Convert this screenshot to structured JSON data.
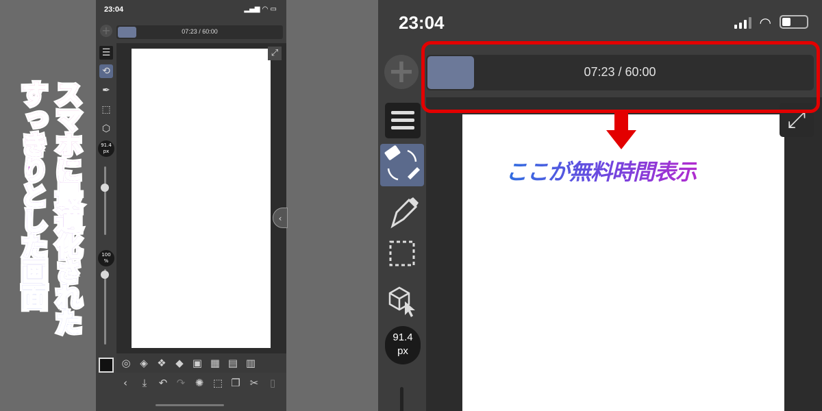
{
  "headline": {
    "line1": "スマホに最適化された",
    "line2": "すっきりとした画面"
  },
  "callout": "ここが無料時間表示",
  "status": {
    "time": "23:04"
  },
  "timer": {
    "text": "07:23 / 60:00",
    "progress_fraction": 0.12
  },
  "brush_size": {
    "value": "91.4",
    "unit": "px"
  },
  "opacity": {
    "value": "100",
    "unit": "%"
  },
  "colors": {
    "progress": "#6c7999",
    "selected_tool": "#5b6a8c",
    "highlight": "#e30000",
    "gradient_start": "#e0218a",
    "gradient_end": "#4b62e6"
  },
  "icons": {
    "tools": [
      "menu-icon",
      "eraser-transform-icon",
      "pen-icon",
      "selection-icon",
      "3d-object-icon"
    ],
    "bottom_row1": [
      "navigator-icon",
      "layers-icon",
      "layer-properties-icon",
      "fill-settings-icon",
      "material-icon",
      "tiles-icon",
      "timeline-icon",
      "calendar-icon"
    ],
    "bottom_row2": [
      "back-icon",
      "save-icon",
      "undo-icon",
      "redo-icon",
      "loading-icon",
      "transform-icon",
      "copy-icon",
      "cut-icon",
      "paste-icon"
    ]
  }
}
